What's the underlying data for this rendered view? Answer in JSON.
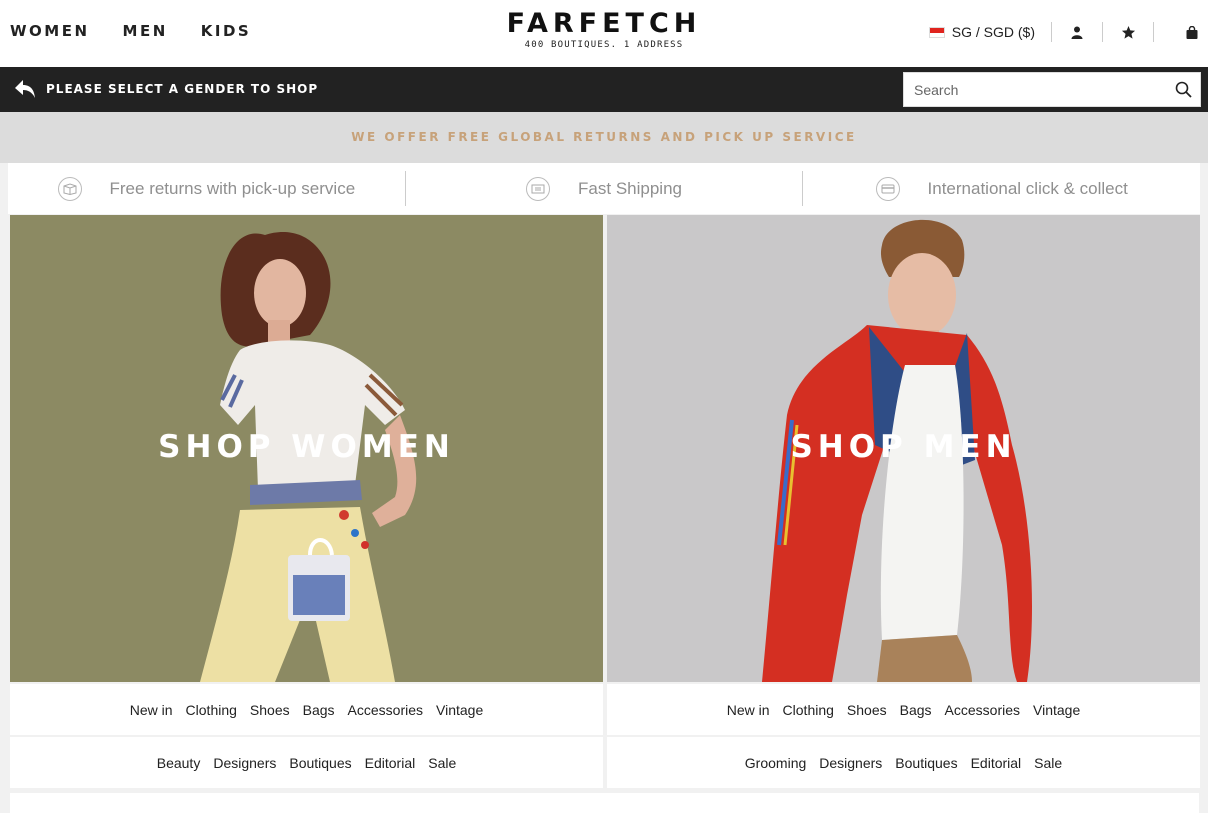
{
  "header": {
    "gender_nav": [
      "WOMEN",
      "MEN",
      "KIDS"
    ],
    "logo": "FARFETCH",
    "logo_tagline": "400 BOUTIQUES. 1 ADDRESS",
    "region": "SG / SGD ($)"
  },
  "subbar": {
    "prompt": "PLEASE SELECT A GENDER TO SHOP",
    "search_placeholder": "Search"
  },
  "promo": {
    "text": "WE OFFER FREE GLOBAL RETURNS AND PICK UP SERVICE"
  },
  "benefits": [
    {
      "label": "Free returns with pick-up service",
      "icon": "box-icon"
    },
    {
      "label": "Fast Shipping",
      "icon": "shipping-icon"
    },
    {
      "label": "International click & collect",
      "icon": "card-icon"
    }
  ],
  "women": {
    "title": "SHOP WOMEN",
    "row1": [
      "New in",
      "Clothing",
      "Shoes",
      "Bags",
      "Accessories",
      "Vintage"
    ],
    "row2": [
      "Beauty",
      "Designers",
      "Boutiques",
      "Editorial",
      "Sale"
    ]
  },
  "men": {
    "title": "SHOP MEN",
    "row1": [
      "New in",
      "Clothing",
      "Shoes",
      "Bags",
      "Accessories",
      "Vintage"
    ],
    "row2": [
      "Grooming",
      "Designers",
      "Boutiques",
      "Editorial",
      "Sale"
    ]
  },
  "colors": {
    "promo_text": "#c7a27a",
    "black_bar": "#222222",
    "women_bg": "#8c8a63",
    "men_bg": "#c9c8c9"
  }
}
